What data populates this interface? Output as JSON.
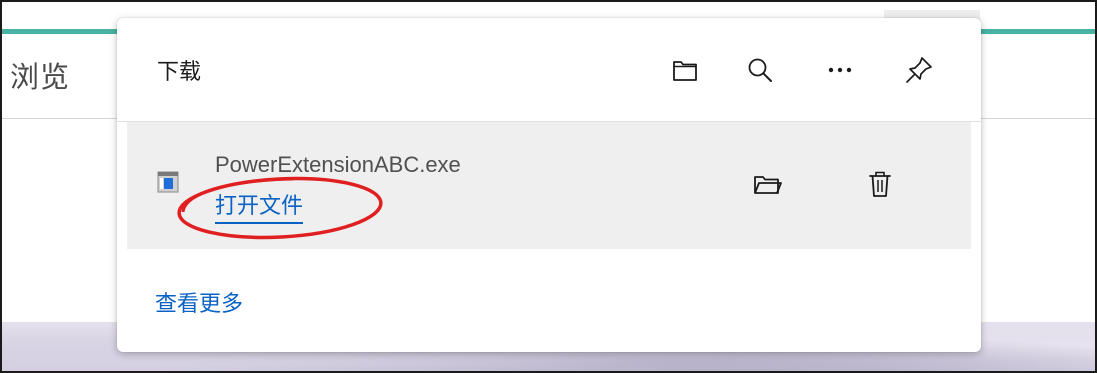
{
  "background": {
    "label": "浏览",
    "accent_color": "#49b3a3"
  },
  "downloads_panel": {
    "title": "下载",
    "header_icons": [
      "folder-icon",
      "search-icon",
      "more-options-icon",
      "pin-icon"
    ],
    "item": {
      "file_name": "PowerExtensionABC.exe",
      "open_link": "打开文件",
      "actions": [
        "show-in-folder-icon",
        "delete-icon"
      ]
    },
    "see_more": "查看更多",
    "link_color": "#0a63c4",
    "annotation_color": "#e02020"
  }
}
